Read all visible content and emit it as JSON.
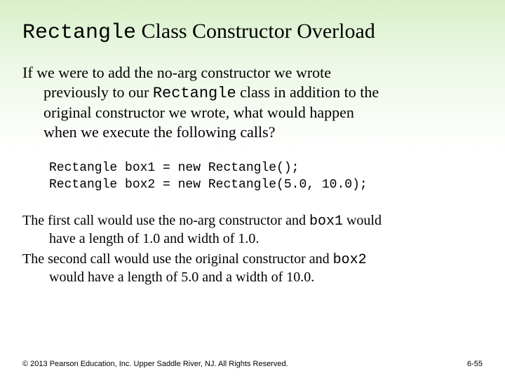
{
  "title": {
    "code_prefix": "Rectangle",
    "rest": " Class Constructor Overload"
  },
  "para1": {
    "lead": "If we were to add the no-arg constructor we wrote",
    "cont1a": "previously to our ",
    "cont1_code": "Rectangle",
    "cont1b": " class in addition to the",
    "cont2": "original constructor we wrote, what would happen",
    "cont3": "when we execute the following calls?"
  },
  "code": {
    "line1": "Rectangle box1 = new Rectangle();",
    "line2": "Rectangle box2 = new Rectangle(5.0, 10.0);"
  },
  "para2": {
    "s1a": "The first call would use the no-arg constructor and ",
    "s1_code": "box1",
    "s1b": " would",
    "s1c": "have a length of 1.0 and width of 1.0.",
    "s2a": "The second call would use the original constructor and ",
    "s2_code": "box2",
    "s2c": "would have a length of 5.0 and a width of 10.0."
  },
  "footer": {
    "copyright": "© 2013 Pearson Education, Inc. Upper Saddle River, NJ. All Rights Reserved.",
    "pagenum": "6-55"
  }
}
